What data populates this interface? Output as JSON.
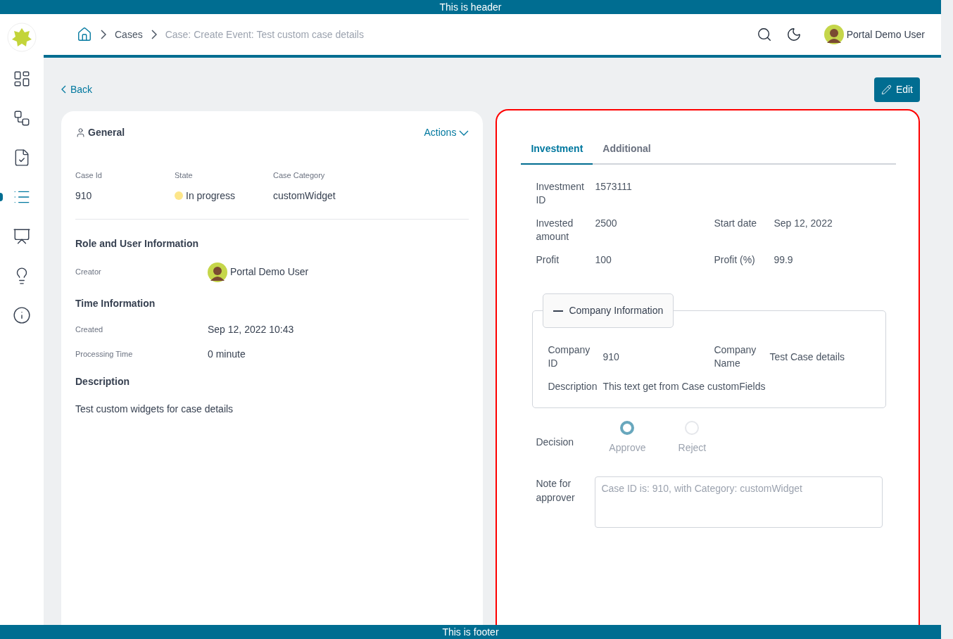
{
  "header": {
    "text": "This is header"
  },
  "footer": {
    "text": "This is footer"
  },
  "sidebar": {
    "items": [
      {
        "selected": false
      },
      {
        "selected": false
      },
      {
        "selected": false
      },
      {
        "selected": true
      },
      {
        "selected": false
      },
      {
        "selected": false
      },
      {
        "selected": false
      }
    ]
  },
  "breadcrumb": [
    "Cases",
    "Case: Create Event: Test custom case details"
  ],
  "user": {
    "name": "Portal Demo User"
  },
  "back": "Back",
  "edit": "Edit",
  "general": {
    "title": "General",
    "actions": "Actions",
    "fields": [
      {
        "label": "Case Id",
        "value": "910"
      },
      {
        "label": "State",
        "value": "In progress",
        "color": "#fde68a"
      },
      {
        "label": "Case Category",
        "value": "customWidget"
      }
    ],
    "sections": [
      {
        "title": "Role and User Information",
        "rows": [
          {
            "kind": "user",
            "label": "Creator",
            "value": "Portal Demo User"
          }
        ]
      },
      {
        "title": "Time Information",
        "rows": [
          {
            "kind": "text",
            "label": "Created",
            "value": "Sep 12, 2022 10:43"
          },
          {
            "kind": "text",
            "label": "Processing Time",
            "value": "0 minute"
          }
        ]
      }
    ],
    "description": {
      "title": "Description",
      "text": "Test custom widgets for case details"
    }
  },
  "details": {
    "tabs": [
      {
        "label": "Investment",
        "selected": true
      },
      {
        "label": "Additional",
        "selected": false
      }
    ],
    "rows": [
      [
        {
          "label": "Investment ID",
          "value": "1573111"
        }
      ],
      [
        {
          "label": "Invested amount",
          "value": "2500"
        },
        {
          "label": "Start date",
          "value": "Sep 12, 2022"
        }
      ],
      [
        {
          "label": "Profit",
          "value": "100"
        },
        {
          "label": "Profit (%)",
          "value": "99.9"
        }
      ]
    ],
    "company": {
      "title": "Company Information",
      "expanded": true,
      "rows": [
        [
          {
            "label": "Company ID",
            "value": "910"
          },
          {
            "label": "Company Name",
            "value": "Test Case details"
          }
        ],
        [
          {
            "label": "Description",
            "value": "This text get from Case customFields"
          }
        ]
      ]
    },
    "decision": {
      "label": "Decision",
      "options": [
        {
          "label": "Approve",
          "selected": true
        },
        {
          "label": "Reject",
          "selected": false
        }
      ]
    },
    "note": {
      "label": "Note for approver",
      "placeholder": "Case ID is: 910, with Category: customWidget"
    }
  }
}
